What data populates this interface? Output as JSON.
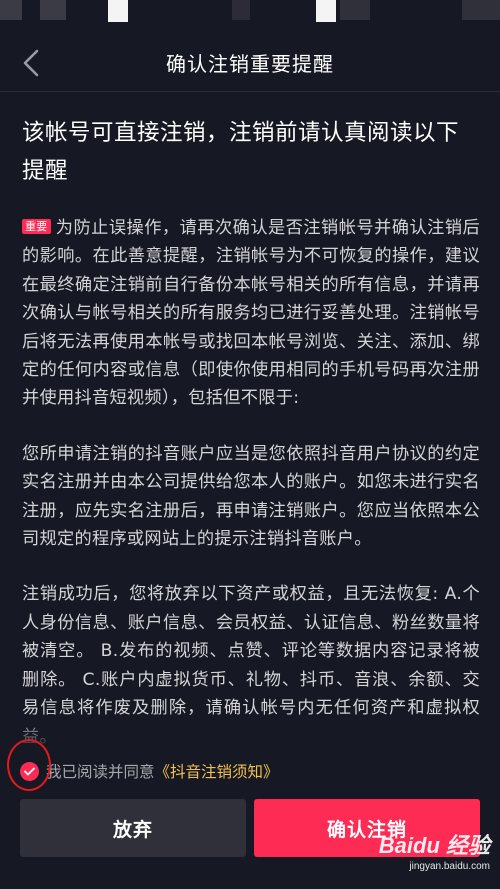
{
  "header": {
    "title": "确认注销重要提醒"
  },
  "content": {
    "headline": "该帐号可直接注销，注销前请认真阅读以下提醒",
    "badge": "重要",
    "para1": "为防止误操作，请再次确认是否注销帐号并确认注销后的影响。在此善意提醒，注销帐号为不可恢复的操作，建议在最终确定注销前自行备份本帐号相关的所有信息，并请再次确认与帐号相关的所有服务均已进行妥善处理。注销帐号后将无法再使用本帐号或找回本帐号浏览、关注、添加、绑定的任何内容或信息（即使你使用相同的手机号码再次注册并使用抖音短视频），包括但不限于:",
    "para2": "您所申请注销的抖音账户应当是您依照抖音用户协议的约定实名注册并由本公司提供给您本人的账户。如您未进行实名注册，应先实名注册后，再申请注销账户。您应当依照本公司规定的程序或网站上的提示注销抖音账户。",
    "para3": "注销成功后，您将放弃以下资产或权益，且无法恢复: A.个人身份信息、账户信息、会员权益、认证信息、粉丝数量将被清空。 B.发布的视频、点赞、评论等数据内容记录将被删除。 C.账户内虚拟货币、礼物、抖币、音浪、余额、交易信息将作废及删除，请确认帐号内无任何资产和虚拟权益。"
  },
  "agreement": {
    "checked": true,
    "text": "我已阅读并同意",
    "link": "《抖音注销须知》"
  },
  "buttons": {
    "cancel": "放弃",
    "confirm": "确认注销"
  },
  "watermark": {
    "logo": "Baidu 经验",
    "url": "jingyan.baidu.com"
  },
  "colors": {
    "background": "#161823",
    "accent": "#fe2c55",
    "link": "#f1c14d",
    "secondary_button": "#2f3039"
  }
}
